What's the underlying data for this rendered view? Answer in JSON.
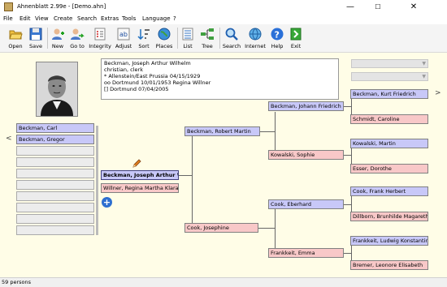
{
  "window": {
    "title": "Ahnenblatt 2.99e - [Demo.ahn]",
    "min_glyph": "—",
    "max_glyph": "☐",
    "close_glyph": "✕"
  },
  "menu": [
    "File",
    "Edit",
    "View",
    "Create",
    "Search",
    "Extras",
    "Tools",
    "Language",
    "?"
  ],
  "toolbar": [
    {
      "label": "Open",
      "icon": "folder-open-icon"
    },
    {
      "label": "Save",
      "icon": "save-icon"
    },
    {
      "label": "New",
      "icon": "new-person-icon"
    },
    {
      "label": "Go to",
      "icon": "goto-person-icon"
    },
    {
      "label": "Integrity",
      "icon": "integrity-check-icon"
    },
    {
      "label": "Adjust",
      "icon": "adjust-icon"
    },
    {
      "label": "Sort",
      "icon": "sort-icon"
    },
    {
      "label": "Places",
      "icon": "places-globe-icon"
    },
    {
      "label": "List",
      "icon": "list-icon"
    },
    {
      "label": "Tree",
      "icon": "tree-icon"
    },
    {
      "label": "Search",
      "icon": "search-icon"
    },
    {
      "label": "Internet",
      "icon": "internet-icon"
    },
    {
      "label": "Help",
      "icon": "help-icon"
    },
    {
      "label": "Exit",
      "icon": "exit-icon"
    }
  ],
  "person_info": {
    "name": "Beckman, Joseph Arthur Wilhelm",
    "religion_occupation": "christian, clerk",
    "birth": "* Allenstein/East Prussia 04/15/1929",
    "marriage": "oo Dortmund 10/01/1953 Regina Willner",
    "death": "[] Dortmund 07/04/2005"
  },
  "children": [
    "Beckman, Carl",
    "Beckman, Gregor"
  ],
  "nav": {
    "left_arrow": "<",
    "right_arrow": ">"
  },
  "tree": {
    "proband": "Beckman, Joseph Arthur Wi",
    "spouse": "Willner, Regina Martha Klara",
    "father": "Beckman, Robert Martin",
    "mother": "Cook, Josephine",
    "pgf": "Beckman, Johann Friedrich",
    "pgm": "Kowalski, Sophie",
    "mgf": "Cook, Eberhard",
    "mgm": "Frankkeit, Emma",
    "gen4": [
      "Beckman, Kurt Friedrich",
      "Schmidt, Caroline",
      "Kowalski, Martin",
      "Esser, Dorothe",
      "Cook, Frank Herbert",
      "Dillborn, Brunhilde Magareth",
      "Frankkeit, Ludwig Konstantin",
      "Bremer, Leonore Elisabeth"
    ]
  },
  "status": "59 persons",
  "colors": {
    "male": "#c8c8f8",
    "female": "#f8c8c8",
    "background": "#fffde7"
  }
}
